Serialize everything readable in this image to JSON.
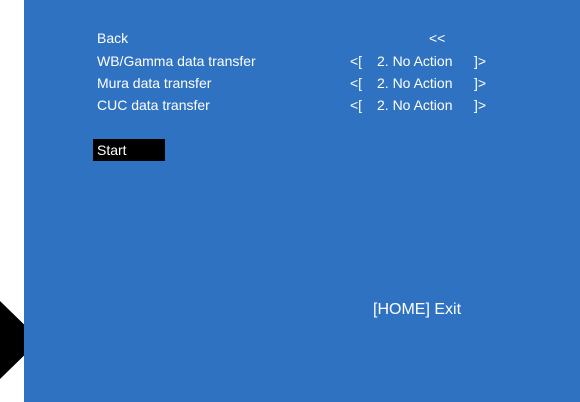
{
  "menu": {
    "back_label": "Back",
    "back_marker": "<<",
    "items": [
      {
        "label": "WB/Gamma data transfer",
        "open": "<[",
        "value": "2. No Action",
        "close": "]>"
      },
      {
        "label": "Mura data transfer",
        "open": "<[",
        "value": "2. No Action",
        "close": "]>"
      },
      {
        "label": "CUC data transfer",
        "open": "<[",
        "value": "2. No Action",
        "close": "]>"
      }
    ],
    "start_label": "Start"
  },
  "footer": {
    "exit_hint": "[HOME] Exit"
  },
  "colors": {
    "screen_background": "#2f72c2",
    "text": "#ffffff",
    "selection_highlight": "#000000"
  },
  "icons": {
    "pointer": "play-arrow-icon"
  }
}
